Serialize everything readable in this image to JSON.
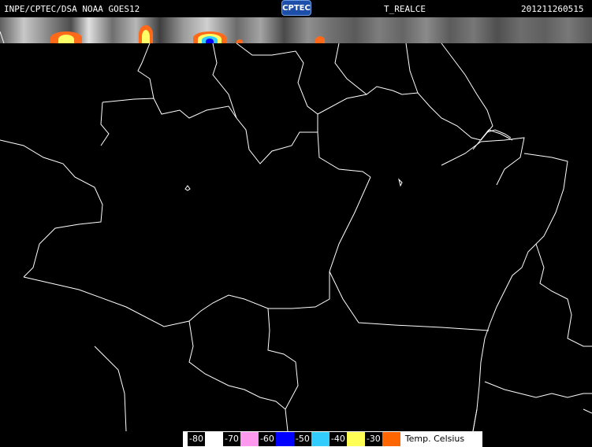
{
  "header": {
    "source": "INPE/CPTEC/DSA NOAA GOES12",
    "logo_text": "CPTEC",
    "product": "T_REALCE",
    "timestamp": "201211260515"
  },
  "legend": {
    "unit_label": "Temp. Celsius",
    "items": [
      {
        "label": "-80",
        "color": "#ffffff"
      },
      {
        "label": "-70",
        "color": "#ff99ee"
      },
      {
        "label": "-60",
        "color": "#0000ff"
      },
      {
        "label": "-50",
        "color": "#33ccff"
      },
      {
        "label": "-40",
        "color": "#ffff55"
      },
      {
        "label": "-30",
        "color": "#ff6600"
      }
    ]
  },
  "colors": {
    "background": "#000000",
    "borders": "#ffffff",
    "cloud_strip": "grayscale"
  }
}
